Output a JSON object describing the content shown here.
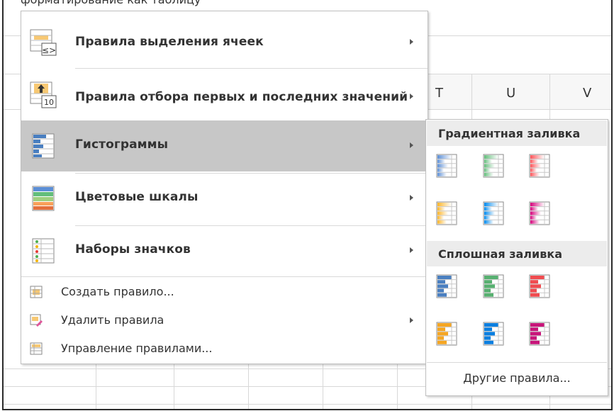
{
  "ribbon": {
    "clipped_text": "форматирование   как таблицу"
  },
  "sheet": {
    "columns": [
      "T",
      "U",
      "V"
    ]
  },
  "menu": {
    "items": [
      {
        "label": "Правила выделения ячеек",
        "icon": "highlight-cells-rules-icon",
        "submenu": true
      },
      {
        "label": "Правила отбора первых и последних значений",
        "icon": "top-bottom-rules-icon",
        "submenu": true
      },
      {
        "label": "Гистограммы",
        "icon": "data-bars-icon",
        "submenu": true,
        "highlighted": true
      },
      {
        "label": "Цветовые шкалы",
        "icon": "color-scales-icon",
        "submenu": true
      },
      {
        "label": "Наборы значков",
        "icon": "icon-sets-icon",
        "submenu": true
      }
    ],
    "small_items": [
      {
        "label": "Создать правило...",
        "icon": "new-rule-icon",
        "submenu": false
      },
      {
        "label": "Удалить правила",
        "icon": "clear-rules-icon",
        "submenu": true
      },
      {
        "label": "Управление правилами...",
        "icon": "manage-rules-icon",
        "submenu": false
      }
    ]
  },
  "submenu": {
    "gradient_header": "Градиентная заливка",
    "solid_header": "Сплошная заливка",
    "more_rules": "Другие правила...",
    "gradient_colors": [
      "#5b8ed6",
      "#63be7b",
      "#ff555a",
      "#ffb628",
      "#008aef",
      "#d6007b"
    ],
    "solid_colors": [
      "#4a7fc0",
      "#57b070",
      "#f04b4f",
      "#f5a623",
      "#0a7fe0",
      "#c8157a"
    ]
  }
}
